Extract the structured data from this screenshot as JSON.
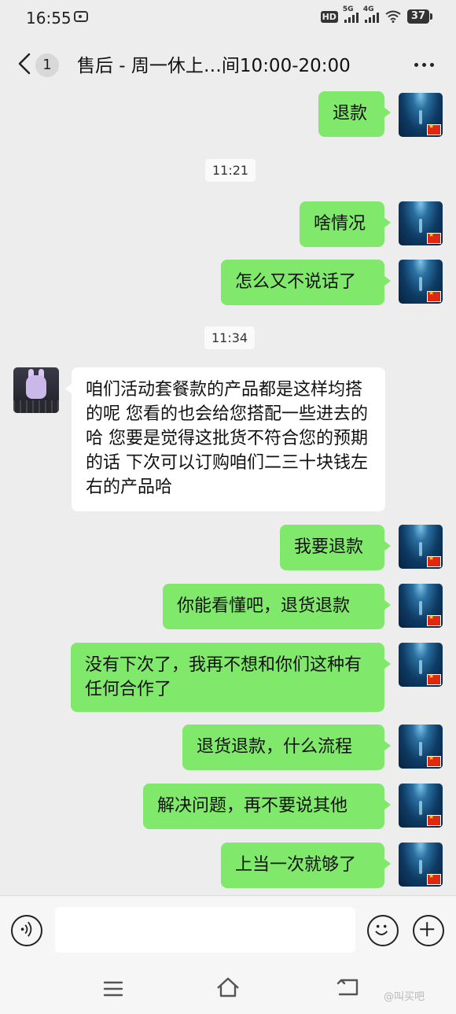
{
  "status_bar": {
    "time": "16:55",
    "hd_badge": "HD",
    "net1": "5G",
    "net2": "4G",
    "battery": "37"
  },
  "header": {
    "unread_count": "1",
    "title": "售后 - 周一休上…间10:00-20:00"
  },
  "messages": [
    {
      "side": "me",
      "text": "退款"
    },
    {
      "time": "11:21"
    },
    {
      "side": "me",
      "text": "啥情况"
    },
    {
      "side": "me",
      "text": "怎么又不说话了"
    },
    {
      "time": "11:34"
    },
    {
      "side": "other",
      "text": "咱们活动套餐款的产品都是这样均搭的呢  您看的也会给您搭配一些进去的哈  您要是觉得这批货不符合您的预期的话 下次可以订购咱们二三十块钱左右的产品哈"
    },
    {
      "side": "me",
      "text": "我要退款"
    },
    {
      "side": "me",
      "text": "你能看懂吧，退货退款"
    },
    {
      "side": "me",
      "text": "没有下次了，我再不想和你们这种有任何合作了"
    },
    {
      "side": "me",
      "text": "退货退款，什么流程"
    },
    {
      "side": "me",
      "text": "解决问题，再不要说其他"
    },
    {
      "side": "me",
      "text": "上当一次就够了"
    }
  ],
  "input_bar": {
    "value": "",
    "icons": [
      "voice-icon",
      "emoji-icon",
      "plus-icon"
    ]
  },
  "watermark": "@叫买吧",
  "colors": {
    "background": "#ededed",
    "my_bubble": "#80e86a",
    "their_bubble": "#ffffff"
  }
}
